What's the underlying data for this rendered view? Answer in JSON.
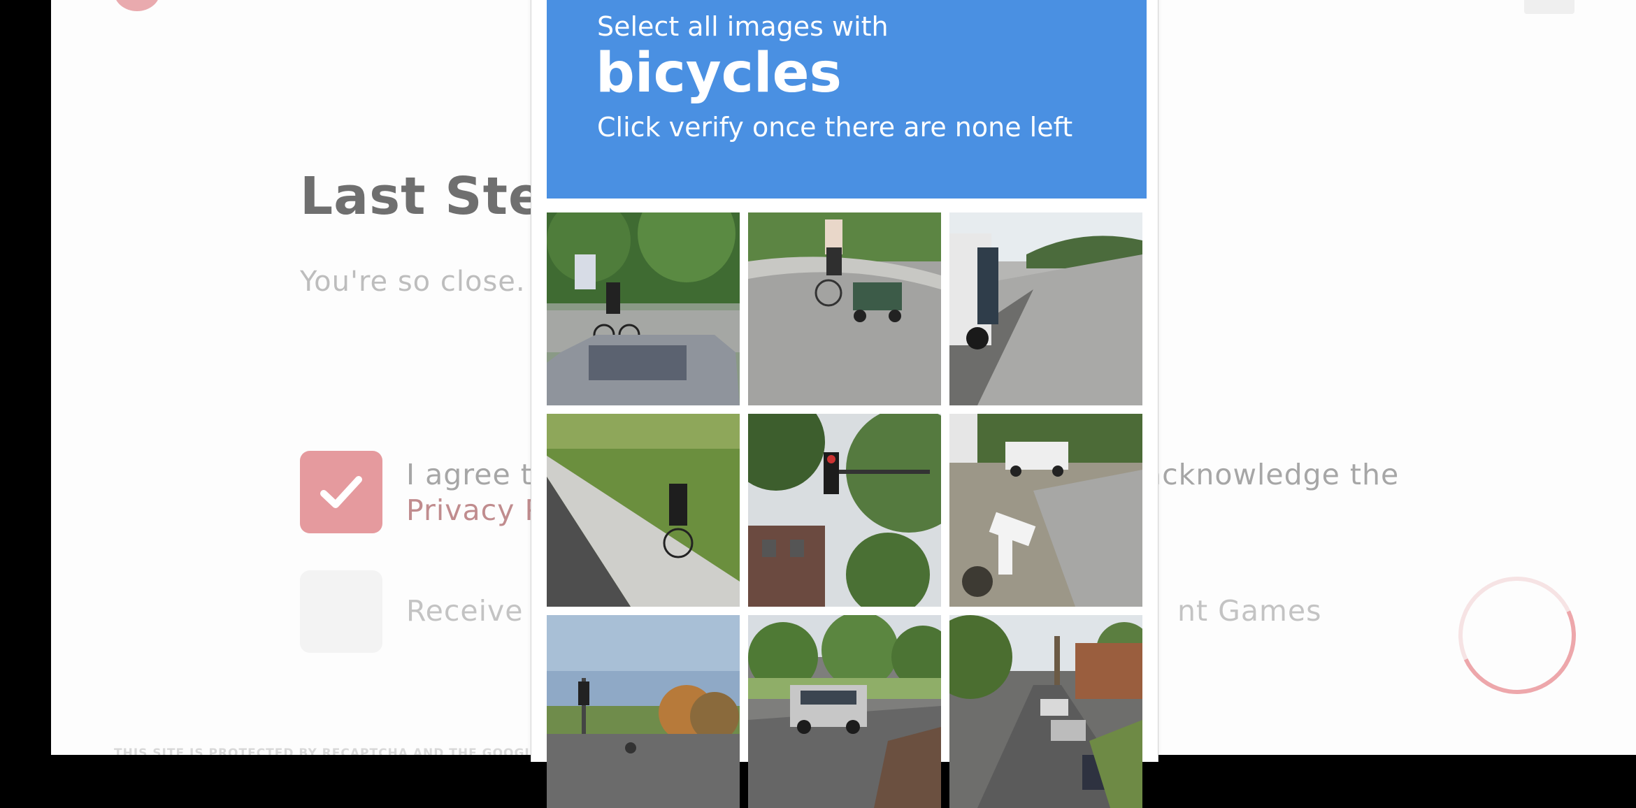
{
  "page": {
    "heading": "Last Step",
    "subheading": "You're so close.",
    "options": [
      {
        "text_left": "I agree to",
        "text_right": "acknowledge the",
        "link": "Privacy Policy",
        "checked": true
      },
      {
        "text_left": "Receive e",
        "text_right": "nt Games",
        "checked": false
      }
    ],
    "footer": "THIS SITE IS PROTECTED BY RECAPTCHA AND THE GOOGLE",
    "accent_color": "#e59a9e",
    "spinner_icon": "loading-spinner"
  },
  "captcha": {
    "instruction": "Select all images with",
    "target": "bicycles",
    "hint": "Click verify once there are none left",
    "header_color": "#4a90e2",
    "tiles": [
      {
        "scene": "cyclist behind parked silver car"
      },
      {
        "scene": "person riding bicycle pulling cart"
      },
      {
        "scene": "highway with semi truck"
      },
      {
        "scene": "cyclist on sidewalk path"
      },
      {
        "scene": "traffic light and trees"
      },
      {
        "scene": "driveway with white car"
      },
      {
        "scene": "intersection with traffic lights"
      },
      {
        "scene": "silver SUV on road"
      },
      {
        "scene": "residential street with parked cars"
      }
    ]
  }
}
